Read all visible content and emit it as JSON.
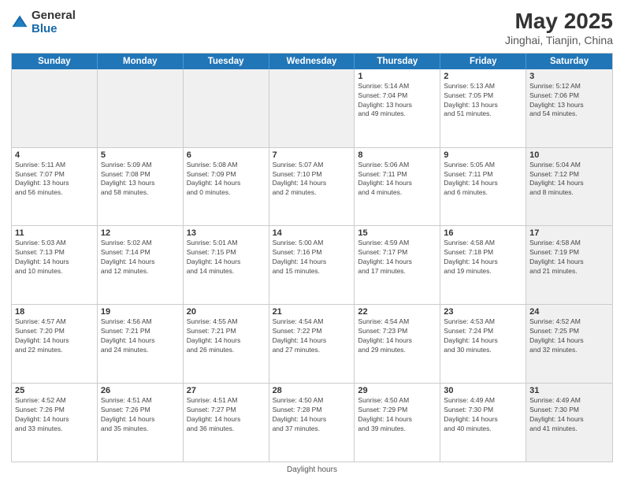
{
  "logo": {
    "general": "General",
    "blue": "Blue"
  },
  "title": "May 2025",
  "subtitle": "Jinghai, Tianjin, China",
  "days_of_week": [
    "Sunday",
    "Monday",
    "Tuesday",
    "Wednesday",
    "Thursday",
    "Friday",
    "Saturday"
  ],
  "footer": "Daylight hours",
  "weeks": [
    [
      {
        "day": "",
        "info": "",
        "shaded": true
      },
      {
        "day": "",
        "info": "",
        "shaded": true
      },
      {
        "day": "",
        "info": "",
        "shaded": true
      },
      {
        "day": "",
        "info": "",
        "shaded": true
      },
      {
        "day": "1",
        "info": "Sunrise: 5:14 AM\nSunset: 7:04 PM\nDaylight: 13 hours\nand 49 minutes.",
        "shaded": false
      },
      {
        "day": "2",
        "info": "Sunrise: 5:13 AM\nSunset: 7:05 PM\nDaylight: 13 hours\nand 51 minutes.",
        "shaded": false
      },
      {
        "day": "3",
        "info": "Sunrise: 5:12 AM\nSunset: 7:06 PM\nDaylight: 13 hours\nand 54 minutes.",
        "shaded": true
      }
    ],
    [
      {
        "day": "4",
        "info": "Sunrise: 5:11 AM\nSunset: 7:07 PM\nDaylight: 13 hours\nand 56 minutes.",
        "shaded": false
      },
      {
        "day": "5",
        "info": "Sunrise: 5:09 AM\nSunset: 7:08 PM\nDaylight: 13 hours\nand 58 minutes.",
        "shaded": false
      },
      {
        "day": "6",
        "info": "Sunrise: 5:08 AM\nSunset: 7:09 PM\nDaylight: 14 hours\nand 0 minutes.",
        "shaded": false
      },
      {
        "day": "7",
        "info": "Sunrise: 5:07 AM\nSunset: 7:10 PM\nDaylight: 14 hours\nand 2 minutes.",
        "shaded": false
      },
      {
        "day": "8",
        "info": "Sunrise: 5:06 AM\nSunset: 7:11 PM\nDaylight: 14 hours\nand 4 minutes.",
        "shaded": false
      },
      {
        "day": "9",
        "info": "Sunrise: 5:05 AM\nSunset: 7:11 PM\nDaylight: 14 hours\nand 6 minutes.",
        "shaded": false
      },
      {
        "day": "10",
        "info": "Sunrise: 5:04 AM\nSunset: 7:12 PM\nDaylight: 14 hours\nand 8 minutes.",
        "shaded": true
      }
    ],
    [
      {
        "day": "11",
        "info": "Sunrise: 5:03 AM\nSunset: 7:13 PM\nDaylight: 14 hours\nand 10 minutes.",
        "shaded": false
      },
      {
        "day": "12",
        "info": "Sunrise: 5:02 AM\nSunset: 7:14 PM\nDaylight: 14 hours\nand 12 minutes.",
        "shaded": false
      },
      {
        "day": "13",
        "info": "Sunrise: 5:01 AM\nSunset: 7:15 PM\nDaylight: 14 hours\nand 14 minutes.",
        "shaded": false
      },
      {
        "day": "14",
        "info": "Sunrise: 5:00 AM\nSunset: 7:16 PM\nDaylight: 14 hours\nand 15 minutes.",
        "shaded": false
      },
      {
        "day": "15",
        "info": "Sunrise: 4:59 AM\nSunset: 7:17 PM\nDaylight: 14 hours\nand 17 minutes.",
        "shaded": false
      },
      {
        "day": "16",
        "info": "Sunrise: 4:58 AM\nSunset: 7:18 PM\nDaylight: 14 hours\nand 19 minutes.",
        "shaded": false
      },
      {
        "day": "17",
        "info": "Sunrise: 4:58 AM\nSunset: 7:19 PM\nDaylight: 14 hours\nand 21 minutes.",
        "shaded": true
      }
    ],
    [
      {
        "day": "18",
        "info": "Sunrise: 4:57 AM\nSunset: 7:20 PM\nDaylight: 14 hours\nand 22 minutes.",
        "shaded": false
      },
      {
        "day": "19",
        "info": "Sunrise: 4:56 AM\nSunset: 7:21 PM\nDaylight: 14 hours\nand 24 minutes.",
        "shaded": false
      },
      {
        "day": "20",
        "info": "Sunrise: 4:55 AM\nSunset: 7:21 PM\nDaylight: 14 hours\nand 26 minutes.",
        "shaded": false
      },
      {
        "day": "21",
        "info": "Sunrise: 4:54 AM\nSunset: 7:22 PM\nDaylight: 14 hours\nand 27 minutes.",
        "shaded": false
      },
      {
        "day": "22",
        "info": "Sunrise: 4:54 AM\nSunset: 7:23 PM\nDaylight: 14 hours\nand 29 minutes.",
        "shaded": false
      },
      {
        "day": "23",
        "info": "Sunrise: 4:53 AM\nSunset: 7:24 PM\nDaylight: 14 hours\nand 30 minutes.",
        "shaded": false
      },
      {
        "day": "24",
        "info": "Sunrise: 4:52 AM\nSunset: 7:25 PM\nDaylight: 14 hours\nand 32 minutes.",
        "shaded": true
      }
    ],
    [
      {
        "day": "25",
        "info": "Sunrise: 4:52 AM\nSunset: 7:26 PM\nDaylight: 14 hours\nand 33 minutes.",
        "shaded": false
      },
      {
        "day": "26",
        "info": "Sunrise: 4:51 AM\nSunset: 7:26 PM\nDaylight: 14 hours\nand 35 minutes.",
        "shaded": false
      },
      {
        "day": "27",
        "info": "Sunrise: 4:51 AM\nSunset: 7:27 PM\nDaylight: 14 hours\nand 36 minutes.",
        "shaded": false
      },
      {
        "day": "28",
        "info": "Sunrise: 4:50 AM\nSunset: 7:28 PM\nDaylight: 14 hours\nand 37 minutes.",
        "shaded": false
      },
      {
        "day": "29",
        "info": "Sunrise: 4:50 AM\nSunset: 7:29 PM\nDaylight: 14 hours\nand 39 minutes.",
        "shaded": false
      },
      {
        "day": "30",
        "info": "Sunrise: 4:49 AM\nSunset: 7:30 PM\nDaylight: 14 hours\nand 40 minutes.",
        "shaded": false
      },
      {
        "day": "31",
        "info": "Sunrise: 4:49 AM\nSunset: 7:30 PM\nDaylight: 14 hours\nand 41 minutes.",
        "shaded": true
      }
    ]
  ]
}
